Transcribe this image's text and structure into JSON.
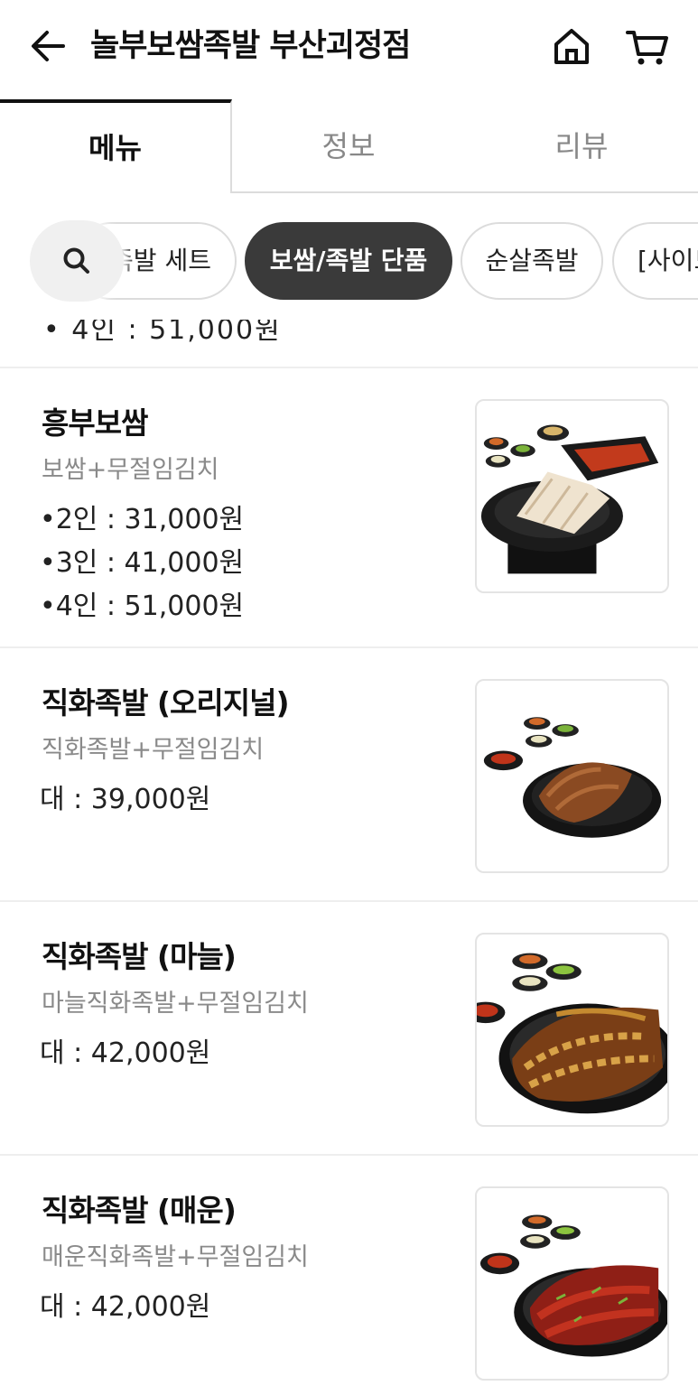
{
  "header": {
    "title": "놀부보쌈족발 부산괴정점",
    "back_icon": "back-arrow-icon",
    "home_icon": "home-icon",
    "cart_icon": "cart-icon"
  },
  "tabs": [
    {
      "label": "메뉴"
    },
    {
      "label": "정보"
    },
    {
      "label": "리뷰"
    }
  ],
  "categories": {
    "search_icon": "search-icon",
    "items": [
      {
        "label": "족발 세트"
      },
      {
        "label": "보쌈/족발 단품",
        "selected": true
      },
      {
        "label": "순살족발"
      },
      {
        "label": "[사이드"
      }
    ]
  },
  "previous_item_cutoff": "• 4인 : 51,000원",
  "menu_items": [
    {
      "name": "흥부보쌈",
      "description": "보쌈+무절임김치",
      "prices": [
        "•2인 : 31,000원",
        "•3인 : 41,000원",
        "•4인 : 51,000원"
      ]
    },
    {
      "name": "직화족발 (오리지널)",
      "description": "직화족발+무절임김치",
      "prices": [
        "대 : 39,000원"
      ]
    },
    {
      "name": "직화족발 (마늘)",
      "description": "마늘직화족발+무절임김치",
      "prices": [
        "대 : 42,000원"
      ]
    },
    {
      "name": "직화족발 (매운)",
      "description": "매운직화족발+무절임김치",
      "prices": [
        "대 : 42,000원"
      ]
    }
  ]
}
